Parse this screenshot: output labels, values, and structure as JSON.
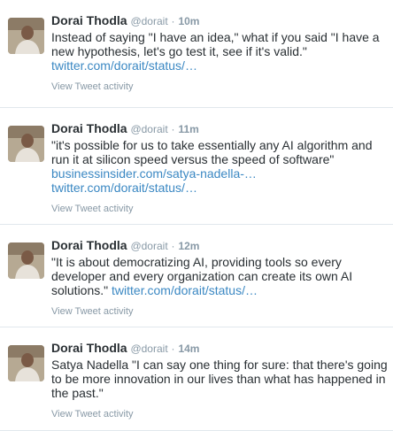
{
  "tweets": [
    {
      "author": "Dorai Thodla",
      "handle": "@dorait",
      "time": "10m",
      "text": "Instead of saying \"I have an idea,\" what if you said \"I have a new hypothesis, let's go test it, see if it's valid.\"",
      "links": [
        "twitter.com/dorait/status/…"
      ],
      "activity": "View Tweet activity"
    },
    {
      "author": "Dorai Thodla",
      "handle": "@dorait",
      "time": "11m",
      "text": "\"it's possible for us to take essentially any AI algorithm and run it at silicon speed versus the speed of software\"",
      "links": [
        "businessinsider.com/satya-nadella-…",
        "twitter.com/dorait/status/…"
      ],
      "activity": "View Tweet activity"
    },
    {
      "author": "Dorai Thodla",
      "handle": "@dorait",
      "time": "12m",
      "text": "\"It is about democratizing AI, providing tools so every developer and every organization can create its own AI solutions.\"",
      "links": [
        "twitter.com/dorait/status/…"
      ],
      "activity": "View Tweet activity"
    },
    {
      "author": "Dorai Thodla",
      "handle": "@dorait",
      "time": "14m",
      "text": "Satya Nadella \"I can say one thing for sure: that there's going to be more innovation in our lives than what has happened in the past.\"",
      "links": [],
      "activity": "View Tweet activity"
    }
  ]
}
